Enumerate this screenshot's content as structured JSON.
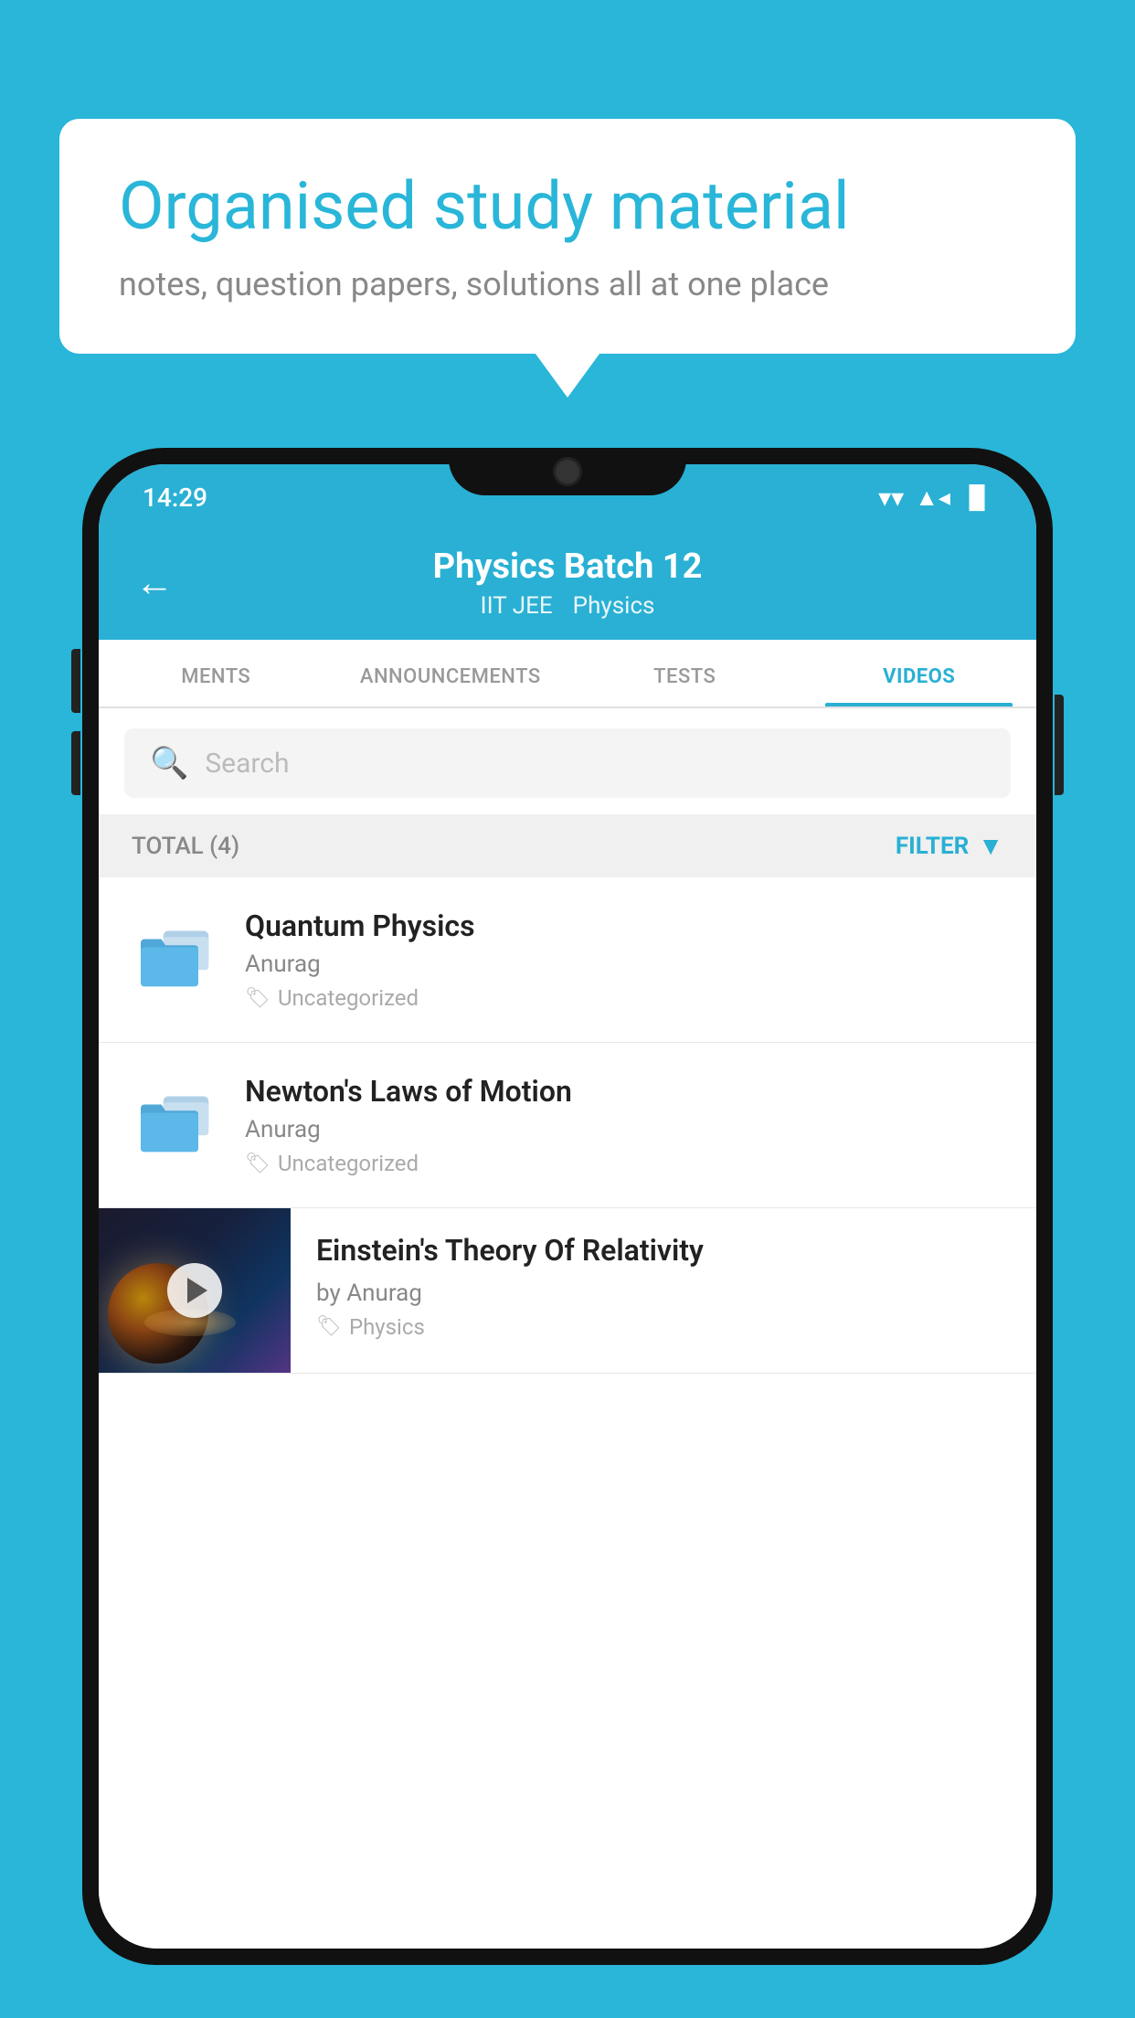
{
  "background_color": "#29b6d8",
  "speech_bubble": {
    "title": "Organised study material",
    "subtitle": "notes, question papers, solutions all at one place"
  },
  "phone": {
    "status_bar": {
      "time": "14:29",
      "wifi": "▼",
      "signal": "▲",
      "battery": "▐"
    },
    "header": {
      "back_label": "←",
      "title": "Physics Batch 12",
      "subtitle1": "IIT JEE",
      "subtitle2": "Physics"
    },
    "tabs": [
      {
        "label": "MENTS",
        "active": false
      },
      {
        "label": "ANNOUNCEMENTS",
        "active": false
      },
      {
        "label": "TESTS",
        "active": false
      },
      {
        "label": "VIDEOS",
        "active": true
      }
    ],
    "search": {
      "placeholder": "Search"
    },
    "filter_bar": {
      "total_label": "TOTAL (4)",
      "filter_label": "FILTER"
    },
    "video_items": [
      {
        "id": 1,
        "title": "Quantum Physics",
        "author": "Anurag",
        "tag": "Uncategorized",
        "type": "folder"
      },
      {
        "id": 2,
        "title": "Newton's Laws of Motion",
        "author": "Anurag",
        "tag": "Uncategorized",
        "type": "folder"
      },
      {
        "id": 3,
        "title": "Einstein's Theory Of Relativity",
        "author": "by Anurag",
        "tag": "Physics",
        "type": "video"
      }
    ]
  }
}
